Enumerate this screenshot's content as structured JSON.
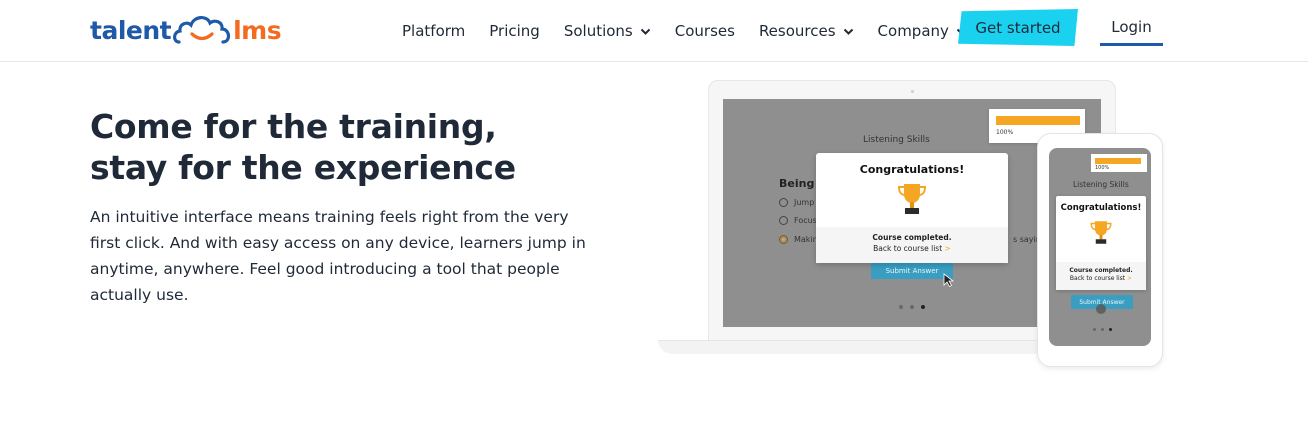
{
  "brand": {
    "part1": "talent",
    "part2": "lms",
    "color_primary": "#1e5aa8",
    "color_accent": "#f26b21"
  },
  "nav": {
    "items": [
      {
        "label": "Platform",
        "dropdown": false
      },
      {
        "label": "Pricing",
        "dropdown": false
      },
      {
        "label": "Solutions",
        "dropdown": true
      },
      {
        "label": "Courses",
        "dropdown": false
      },
      {
        "label": "Resources",
        "dropdown": true
      },
      {
        "label": "Company",
        "dropdown": true
      }
    ],
    "cta_label": "Get started",
    "cta_color": "#1ad2f0",
    "login_label": "Login"
  },
  "hero": {
    "title_line1": "Come for the training,",
    "title_line2": "stay for the experience",
    "body": "An intuitive interface means training feels right from the very first click. And with easy access on any device, learners jump in anytime, anywhere. Feel good introducing a tool that people actually use."
  },
  "laptop_screen": {
    "progress_label": "100%",
    "progress": 1.0,
    "lesson_title": "Listening Skills",
    "question": "Being a",
    "options": [
      {
        "label": "Jump",
        "selected": false
      },
      {
        "label": "Focus",
        "selected": false
      },
      {
        "label": "Makin",
        "selected": true
      }
    ],
    "trailing_text": "s saying",
    "submit_label": "Submit Answer",
    "modal": {
      "title": "Congratulations!",
      "completed": "Course completed.",
      "back_label": "Back to course list",
      "back_arrow": ">"
    }
  },
  "phone_screen": {
    "progress_label": "100%",
    "lesson_title": "Listening Skills",
    "modal": {
      "title": "Congratulations!",
      "completed": "Course completed.",
      "back_label": "Back to course list",
      "back_arrow": ">"
    },
    "submit_label": "Submit Answer"
  }
}
